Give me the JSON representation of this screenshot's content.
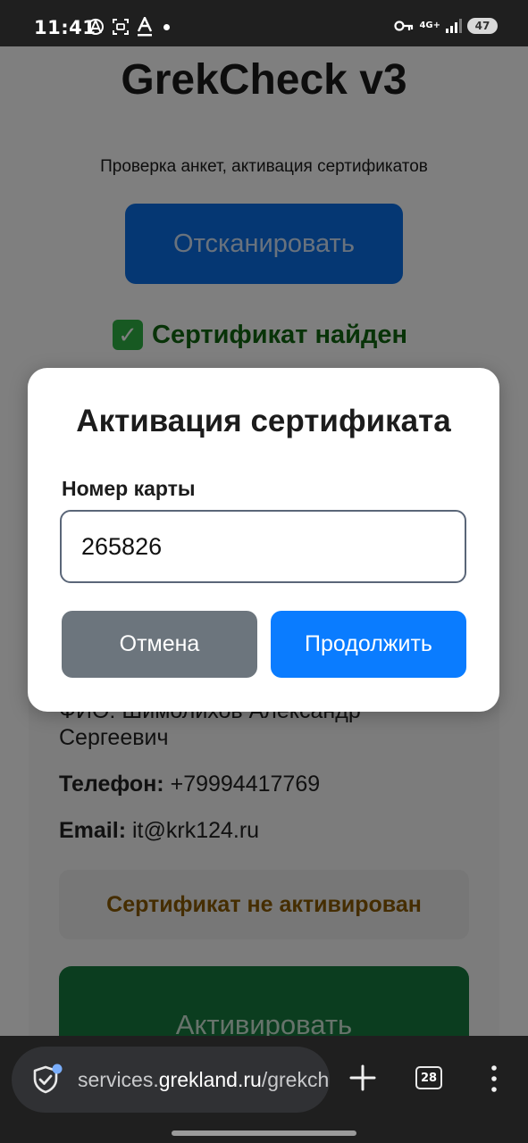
{
  "status_bar": {
    "time": "11:41",
    "network": "4G+",
    "battery": "47",
    "icons": [
      "vpn-anarchy-icon",
      "screenshot-icon",
      "text-icon",
      "notification-dot",
      "key-icon",
      "signal-icon"
    ]
  },
  "page": {
    "title": "GrekCheck v3",
    "subtitle": "Проверка анкет, активация сертификатов",
    "scan_button": "Отсканировать",
    "found_text": "Сертификат найден",
    "fio_cut": "ФИО: Шимолихов Александр",
    "fio_second": "Сергеевич",
    "phone_label": "Телефон:",
    "phone_value": "+79994417769",
    "email_label": "Email:",
    "email_value": "it@krk124.ru",
    "status_badge": "Сертификат не активирован",
    "activate_button": "Активировать"
  },
  "modal": {
    "title": "Активация сертификата",
    "field_label": "Номер карты",
    "field_value": "265826",
    "cancel": "Отмена",
    "continue": "Продолжить"
  },
  "browser": {
    "url_host": "services.",
    "url_host_main": "grekland.ru",
    "url_path": "/grekcheck",
    "tabs": "28"
  },
  "colors": {
    "primary": "#0a7cff",
    "secondary": "#6c757d",
    "success": "#167a3e",
    "warning_text": "#8a5a00"
  }
}
